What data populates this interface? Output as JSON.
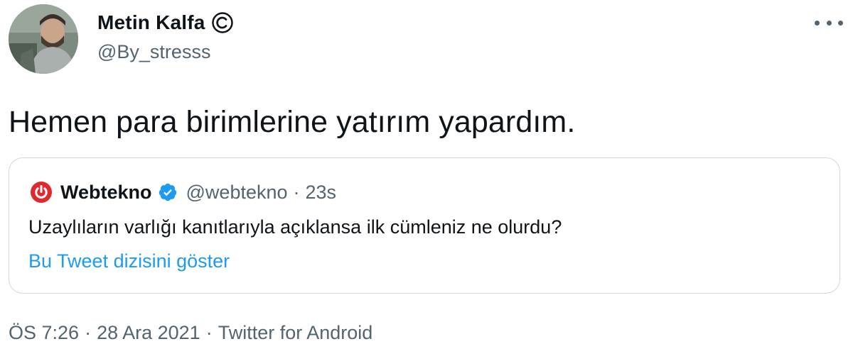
{
  "author": {
    "display_name": "Metin Kalfa",
    "handle": "@By_stresss",
    "avatar_icon": "user-photo-avatar",
    "badge_icon": "copyright-icon"
  },
  "tweet": {
    "text": "Hemen para birimlerine yatırım yapardım.",
    "more_icon": "more-horizontal-icon"
  },
  "quoted_tweet": {
    "logo_icon": "power-logo-icon",
    "name": "Webtekno",
    "verified_icon": "verified-badge-icon",
    "handle": "@webtekno",
    "separator": "·",
    "time": "23s",
    "text": "Uzaylıların varlığı kanıtlarıyla açıklansa ilk cümleniz ne olurdu?",
    "show_thread_link": "Bu Tweet dizisini göster"
  },
  "meta": {
    "time": "ÖS 7:26",
    "separator": "·",
    "date": "28 Ara 2021",
    "source": "Twitter for Android"
  },
  "colors": {
    "text_primary": "#0f1419",
    "text_secondary": "#536471",
    "link_blue": "#1d9bf0",
    "border": "#cfd9de",
    "logo_red": "#e0292f"
  }
}
